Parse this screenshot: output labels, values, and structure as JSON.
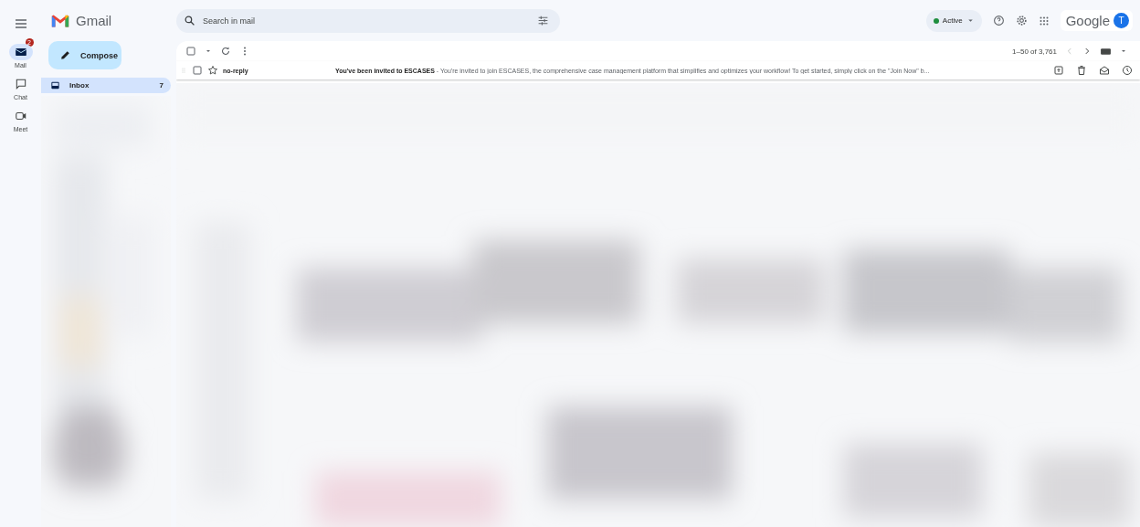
{
  "header": {
    "app_name": "Gmail",
    "search": {
      "placeholder": "Search in mail"
    },
    "status": {
      "label": "Active",
      "color": "#1e8e3e"
    },
    "account": {
      "brand": "Google",
      "avatar": "T"
    }
  },
  "rail": [
    {
      "label": "Mail",
      "selected": true,
      "badge": "2",
      "kind": "mail"
    },
    {
      "label": "Chat",
      "selected": false,
      "kind": "chat"
    },
    {
      "label": "Meet",
      "selected": false,
      "kind": "meet"
    }
  ],
  "compose": "Compose",
  "folders": [
    {
      "label": "Inbox",
      "count": "7",
      "selected": true
    }
  ],
  "toolbar": {
    "range": "1–50 of 3,761"
  },
  "emails": [
    {
      "sender": "no-reply",
      "subject": "You've been invited to ESCASES",
      "snippet": " - You're invited to join ESCASES, the comprehensive case management platform that simplifies and optimizes your workflow! To get started, simply click on the \"Join Now\" b...",
      "starred": false,
      "checked": false,
      "unread": true
    }
  ]
}
